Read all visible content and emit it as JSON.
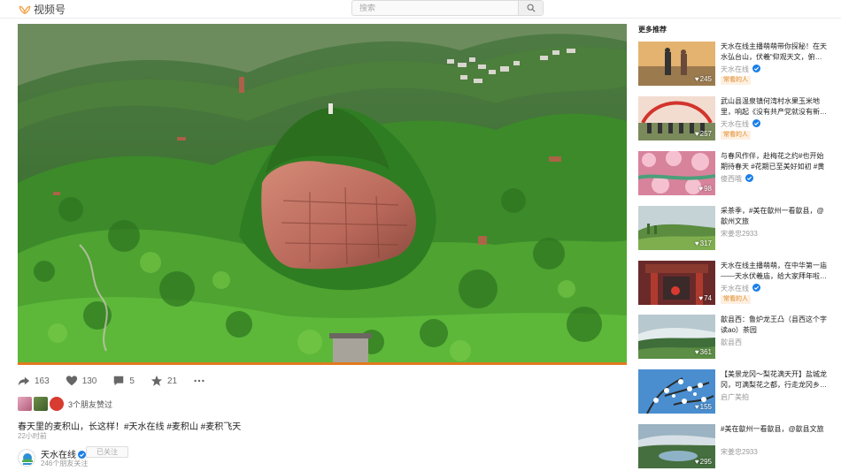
{
  "header": {
    "logo_text": "视频号",
    "search_placeholder": "搜索"
  },
  "video": {
    "progress_fraction": 1.0
  },
  "actions": {
    "share_count": "163",
    "like_count": "130",
    "comment_count": "5",
    "favorite_count": "21"
  },
  "friends": {
    "text": "3个朋友赞过"
  },
  "post": {
    "caption": "春天里的麦积山，长这样！#天水在线 #麦积山 #麦积飞天",
    "time": "22小时前"
  },
  "author": {
    "name": "天水在线",
    "follow_label": "已关注",
    "subtext": "246个朋友关注"
  },
  "sidebar": {
    "title": "更多推荐",
    "items": [
      {
        "title": "天水在线主播萌萌带你探秘！在天水弘台山，伏羲“仰观天文，俯…",
        "author": "天水在线",
        "tag": "常看的人",
        "likes": "245"
      },
      {
        "title": "武山县温泉镇何湾村水果玉米地里，响起《没有共产党就没有新…",
        "author": "天水在线",
        "tag": "常看的人",
        "likes": "257"
      },
      {
        "title": "与春风作伴，赴梅花之约#也开始期待春天 #花期已至美好如初 #黄梅…",
        "author": "傻西哦",
        "tag": "",
        "likes": "98"
      },
      {
        "title": "采茶季，#美在歙州一看歙县，@歙州文旅",
        "author": "宋姜忠2933",
        "tag": "",
        "likes": "317"
      },
      {
        "title": "天水在线主播萌萌，在中华第一庙——天水伏羲庙，给大家拜年啦…",
        "author": "天水在线",
        "tag": "常看的人",
        "likes": "74"
      },
      {
        "title": "歙县西：鲁炉龙王凸（县西这个字读ao）茶园",
        "author": "歙县西",
        "tag": "",
        "likes": "361"
      },
      {
        "title": "【美景龙冈～梨花满天开】盐城龙冈，可满梨花之都，行走龙冈乡…",
        "author": "启广美拍",
        "tag": "",
        "likes": "155"
      },
      {
        "title": "#美在歙州一看歙县，@歙县文旅",
        "author": "宋姜忠2933",
        "tag": "",
        "likes": "295"
      }
    ]
  },
  "colors": {
    "accent_orange": "#e07a1f",
    "verified_blue": "#1a7ee8",
    "tag_orange": "#e08a2a"
  }
}
